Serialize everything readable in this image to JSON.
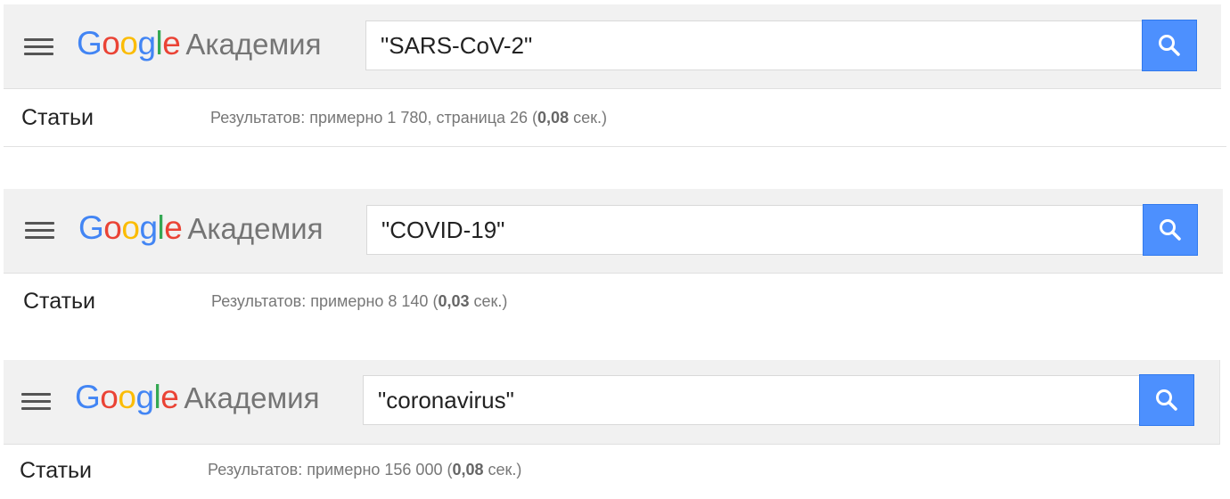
{
  "panels": [
    {
      "menu_icon": "hamburger-menu-icon",
      "logo": {
        "letters": [
          "G",
          "o",
          "o",
          "g",
          "l",
          "e"
        ],
        "product": "Академия"
      },
      "search": {
        "value": "\"SARS-CoV-2\"",
        "button_icon": "search-icon"
      },
      "articles_label": "Статьи",
      "stats": {
        "prefix": "Результатов: примерно 1 780, страница 26 (",
        "time": "0,08",
        "suffix": " сек.)"
      }
    },
    {
      "menu_icon": "hamburger-menu-icon",
      "logo": {
        "letters": [
          "G",
          "o",
          "o",
          "g",
          "l",
          "e"
        ],
        "product": "Академия"
      },
      "search": {
        "value": "\"COVID-19\"",
        "button_icon": "search-icon"
      },
      "articles_label": "Статьи",
      "stats": {
        "prefix": "Результатов: примерно 8 140 (",
        "time": "0,03",
        "suffix": " сек.)"
      }
    },
    {
      "menu_icon": "hamburger-menu-icon",
      "logo": {
        "letters": [
          "G",
          "o",
          "o",
          "g",
          "l",
          "e"
        ],
        "product": "Академия"
      },
      "search": {
        "value": "\"coronavirus\"",
        "button_icon": "search-icon"
      },
      "articles_label": "Статьи",
      "stats": {
        "prefix": "Результатов: примерно 156 000 (",
        "time": "0,08",
        "suffix": " сек.)"
      }
    }
  ],
  "colors": {
    "google_blue": "#4285f4",
    "google_red": "#ea4335",
    "google_yellow": "#fbbc05",
    "google_green": "#34a853",
    "search_button": "#4d90fe",
    "header_bg": "#f1f1f1"
  }
}
